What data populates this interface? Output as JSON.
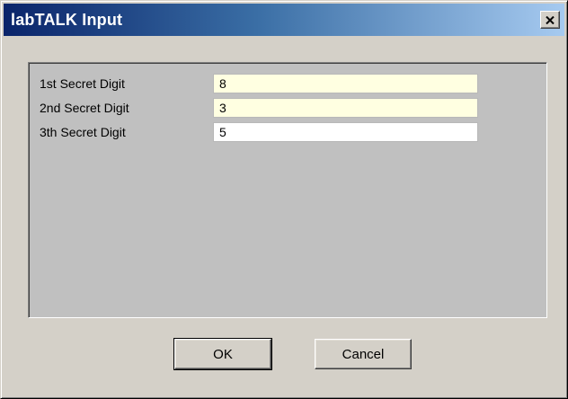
{
  "window": {
    "title": "labTALK Input",
    "close_icon": "close-icon"
  },
  "fields": [
    {
      "label": "1st Secret Digit",
      "value": "8"
    },
    {
      "label": "2nd Secret Digit",
      "value": "3"
    },
    {
      "label": "3th Secret Digit",
      "value": "5"
    }
  ],
  "buttons": {
    "ok_label": "OK",
    "cancel_label": "Cancel"
  },
  "colors": {
    "titlebar_start": "#0a246a",
    "titlebar_end": "#a6caf0",
    "field_tint": "#ffffe1",
    "dialog_face": "#d4d0c8",
    "panel_bg": "#c0c0c0"
  }
}
